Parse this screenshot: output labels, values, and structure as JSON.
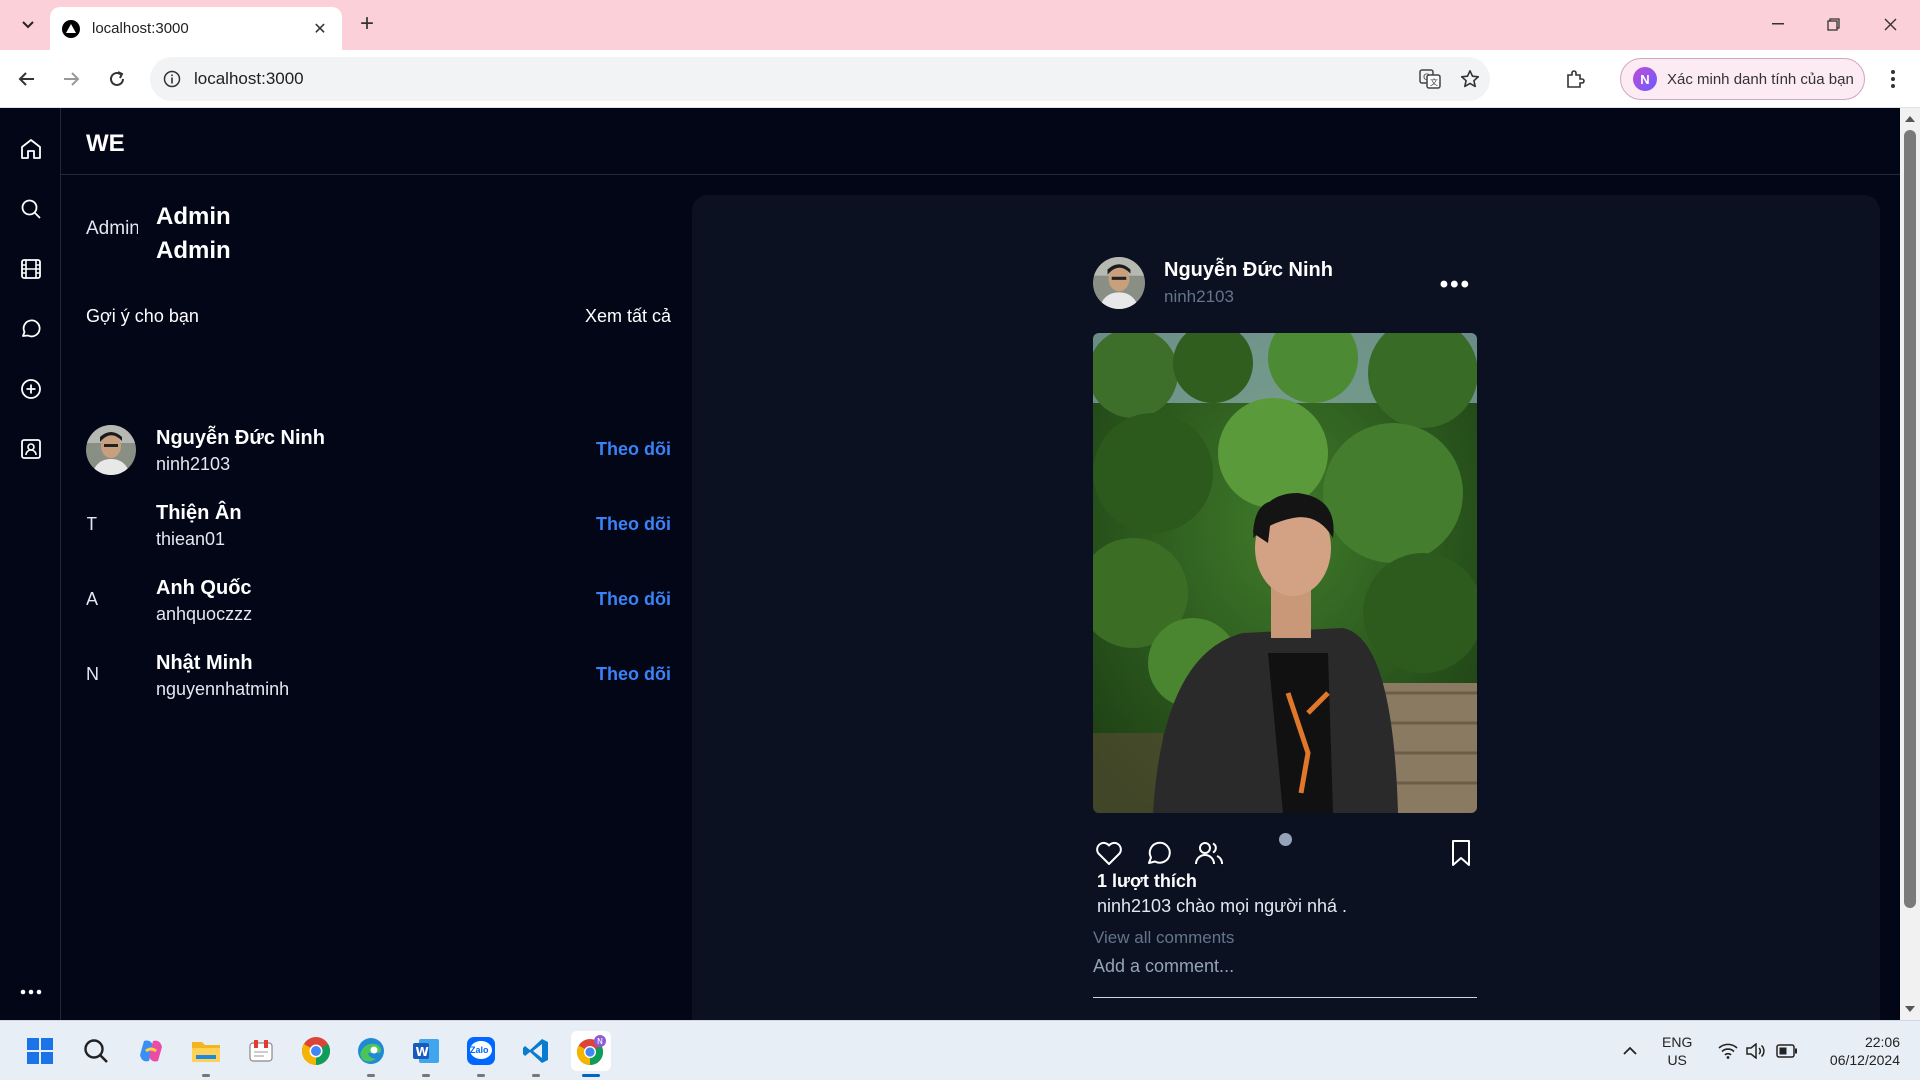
{
  "browser": {
    "tab_title": "localhost:3000",
    "url": "localhost:3000",
    "profile_label": "Xác minh danh tính của bạn",
    "profile_initial": "N"
  },
  "app": {
    "logo": "WE",
    "current_user": {
      "avatar_alt": "Admin",
      "display_name": "Admin",
      "username": "Admin"
    },
    "suggestions": {
      "heading": "Gợi ý cho bạn",
      "see_all": "Xem tất cả",
      "items": [
        {
          "avatar_alt": "",
          "name": "Nguyễn Đức Ninh",
          "username": "ninh2103",
          "action": "Theo dõi"
        },
        {
          "avatar_alt": "T",
          "name": "Thiện Ân",
          "username": "thiean01",
          "action": "Theo dõi"
        },
        {
          "avatar_alt": "A",
          "name": "Anh Quốc",
          "username": "anhquoczzz",
          "action": "Theo dõi"
        },
        {
          "avatar_alt": "N",
          "name": "Nhật Minh",
          "username": "nguyennhatminh",
          "action": "Theo dõi"
        }
      ]
    },
    "post": {
      "author_name": "Nguyễn Đức Ninh",
      "author_username": "ninh2103",
      "more": "•••",
      "likes": "1 lượt thích",
      "caption": "ninh2103 chào mọi người nhá .",
      "view_comments": "View all comments",
      "add_comment_placeholder": "Add a comment..."
    }
  },
  "taskbar": {
    "lang_line1": "ENG",
    "lang_line2": "US",
    "time": "22:06",
    "date": "06/12/2024",
    "zalo_label": "Zalo"
  },
  "colors": {
    "app_bg": "#020617",
    "panel_bg": "#0b1120",
    "follow_blue": "#3b82f6",
    "tab_strip": "#fbd0d9"
  }
}
